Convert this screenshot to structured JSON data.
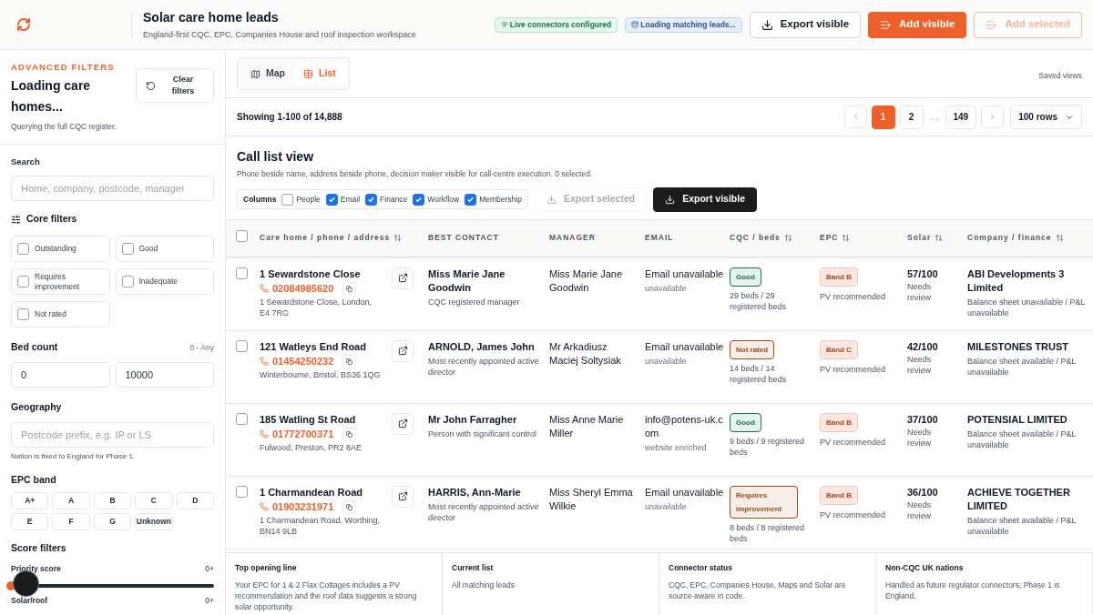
{
  "header": {
    "title": "Solar care home leads",
    "subtitle": "England-first CQC, EPC, Companies House and roof inspection workspace",
    "badges": [
      {
        "kind": "live",
        "label": "Live connectors configured"
      },
      {
        "kind": "loading",
        "label": "Loading matching leads..."
      }
    ],
    "buttons": [
      {
        "kind": "outline",
        "label": "Export visible",
        "disabled": false
      },
      {
        "kind": "primary",
        "label": "Add visible",
        "disabled": false
      },
      {
        "kind": "primary-outline",
        "label": "Add selected",
        "disabled": true
      }
    ]
  },
  "sidebar": {
    "eyebrow": "ADVANCED FILTERS",
    "title": "Loading care homes...",
    "note": "Querying the full CQC register.",
    "clear_button": "Clear filters",
    "search": {
      "label": "Search",
      "placeholder": "Home, company, postcode, manager"
    },
    "core_filters": {
      "title": "Core filters",
      "options": [
        {
          "label": "Outstanding",
          "checked": false
        },
        {
          "label": "Good",
          "checked": false
        },
        {
          "label": "Requires improvement",
          "checked": false
        },
        {
          "label": "Inadequate",
          "checked": false
        },
        {
          "label": "Not rated",
          "checked": false
        }
      ]
    },
    "bed_count": {
      "label": "Bed count",
      "range": "0 - Any",
      "min": "0",
      "max": "10000"
    },
    "geography": {
      "label": "Geography",
      "placeholder": "Postcode prefix, e.g. IP or LS",
      "note": "Nation is fixed to England for Phase 1."
    },
    "epc_band": {
      "label": "EPC band",
      "options": [
        "A+",
        "A",
        "B",
        "C",
        "D",
        "E",
        "F",
        "G",
        "Unknown"
      ]
    },
    "score_filters": {
      "title": "Score filters",
      "sliders": [
        {
          "label": "Priority score",
          "reading": "0+",
          "level": 0
        },
        {
          "label": "Solar/roof",
          "reading": "0+"
        }
      ]
    }
  },
  "view_tabs": [
    {
      "label": "Map",
      "selected": false
    },
    {
      "label": "List",
      "selected": true
    }
  ],
  "saved_views": "Saved views",
  "pagination": {
    "showing": "Showing 1-100 of 14,888",
    "pages": [
      {
        "label": "1",
        "selected": true
      },
      {
        "label": "2",
        "selected": false
      },
      {
        "label": "…",
        "kind": "gap"
      },
      {
        "label": "149",
        "selected": false
      }
    ],
    "rows_per_page": "100 rows"
  },
  "call_list": {
    "title": "Call list view",
    "description": "Phone beside name, address beside phone, decision maker visible for call-centre execution. 0 selected.",
    "columns_label": "Columns",
    "column_toggles": [
      {
        "label": "People",
        "checked": false
      },
      {
        "label": "Email",
        "checked": true
      },
      {
        "label": "Finance",
        "checked": true
      },
      {
        "label": "Workflow",
        "checked": true
      },
      {
        "label": "Membership",
        "checked": true
      }
    ],
    "buttons": [
      {
        "kind": "outline",
        "label": "Export selected",
        "disabled": true
      },
      {
        "kind": "dark",
        "label": "Export visible",
        "disabled": false
      }
    ]
  },
  "table": {
    "all_selected": false,
    "columns": [
      {
        "label": "Care home / phone / address",
        "sortable": true
      },
      {
        "label": "BEST CONTACT",
        "sortable": false
      },
      {
        "label": "MANAGER",
        "sortable": false
      },
      {
        "label": "EMAIL",
        "sortable": false
      },
      {
        "label": "CQC / beds",
        "sortable": true
      },
      {
        "label": "EPC",
        "sortable": true
      },
      {
        "label": "Solar",
        "sortable": true
      },
      {
        "label": "Company / finance",
        "sortable": true
      }
    ],
    "rows": [
      {
        "selected": false,
        "name": "1 Sewardstone Close",
        "phone": "02084985620",
        "address": "1 Sewardstone Close, London, E4 7RG",
        "contact": "Miss Marie Jane Goodwin",
        "contact_role": "CQC registered manager",
        "manager": "Miss Marie Jane Goodwin",
        "email": "Email unavailable",
        "email_note": "unavailable",
        "rating": "Good",
        "color": "#17734a",
        "beds": "29 beds / 29 registered beds",
        "epc": "Band B",
        "epc_note": "PV recommended",
        "solar": "57/100",
        "solar_note": "Needs review",
        "company": "ABI Developments 3 Limited",
        "finance": "Balance sheet unavailable / P&L unavailable"
      },
      {
        "selected": false,
        "name": "121 Watleys End Road",
        "phone": "01454250232",
        "address": "Winterbourne, Bristol, BS36 1QG",
        "contact": "ARNOLD, James John",
        "contact_role": "Most recently appointed active director",
        "manager": "Mr Arkadiusz Maciej Soltysiak",
        "email": "Email unavailable",
        "email_note": "unavailable",
        "rating": "Not rated",
        "color": "#9a4a12",
        "beds": "14 beds / 14 registered beds",
        "epc": "Band C",
        "epc_note": "PV recommended",
        "solar": "42/100",
        "solar_note": "Needs review",
        "company": "MILESTONES TRUST",
        "finance": "Balance sheet available / P&L unavailable"
      },
      {
        "selected": false,
        "name": "185 Watling St Road",
        "phone": "01772700371",
        "address": "Fulwood, Preston, PR2 8AE",
        "contact": "Mr John Farragher",
        "contact_role": "Person with significant control",
        "manager": "Miss Anne Marie Miller",
        "email": "info@potens-uk.com",
        "email_note": "website enriched",
        "rating": "Good",
        "color": "#17734a",
        "beds": "9 beds / 9 registered beds",
        "epc": "Band B",
        "epc_note": "PV recommended",
        "solar": "37/100",
        "solar_note": "Needs review",
        "company": "POTENSIAL LIMITED",
        "finance": "Balance sheet available / P&L unavailable"
      },
      {
        "selected": false,
        "name": "1 Charmandean Road",
        "phone": "01903231971",
        "address": "1 Charmandean Road, Worthing, BN14 9LB",
        "contact": "HARRIS, Ann-Marie",
        "contact_role": "Most recently appointed active director",
        "manager": "Miss Sheryl Emma Wilkie",
        "email": "Email unavailable",
        "email_note": "unavailable",
        "rating": "Requires improvement",
        "color": "#9a4a12",
        "beds": "8 beds / 8 registered beds",
        "epc": "Band B",
        "epc_note": "PV recommended",
        "solar": "36/100",
        "solar_note": "Needs review",
        "company": "ACHIEVE TOGETHER LIMITED",
        "finance": "Balance sheet available / P&L unavailable"
      }
    ]
  },
  "info_cards": [
    {
      "title": "Top opening line",
      "text": "Your EPC for 1 & 2 Flax Cottages includes a PV recommendation and the roof data suggests a strong solar opportunity."
    },
    {
      "title": "Current list",
      "text": "All matching leads"
    },
    {
      "title": "Connector status",
      "text": "CQC, EPC, Companies House, Maps and Solar are source-aware in code."
    },
    {
      "title": "Non-CQC UK nations",
      "text": "Handled as future regulator connectors; Phase 1 is England."
    }
  ]
}
